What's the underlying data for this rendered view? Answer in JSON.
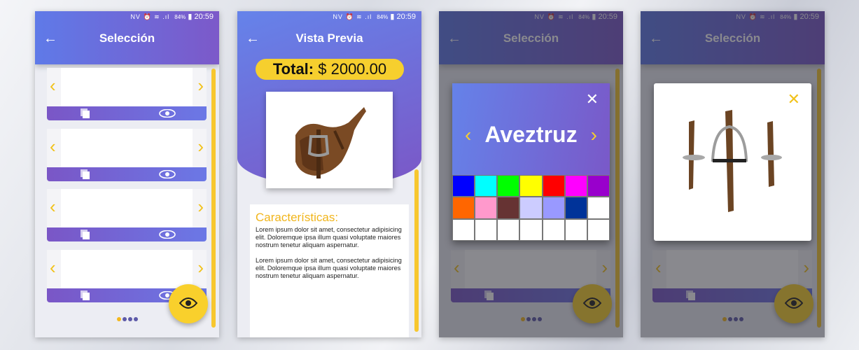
{
  "status": {
    "icons": "NV ⏰ ≋ .ıl",
    "battery": "84%",
    "time": "20:59"
  },
  "screens": {
    "selection": {
      "title": "Selección",
      "back": "←",
      "chev_left": "‹",
      "chev_right": "›"
    },
    "preview": {
      "title": "Vista Previa",
      "back": "←",
      "total_label": "Total:",
      "total_value": "$ 2000.00",
      "features_title": "Características:",
      "paragraphs": [
        "Lorem ipsum dolor sit amet, consectetur adipisicing elit. Doloremque ipsa illum quasi voluptate maiores nostrum tenetur aliquam aspernatur.",
        "Lorem ipsum dolor sit amet, consectetur adipisicing elit. Doloremque ipsa illum quasi voluptate maiores nostrum tenetur aliquam aspernatur."
      ]
    },
    "color_dialog": {
      "name": "Aveztruz",
      "close": "✕",
      "swatches": [
        "#0000ff",
        "#00ffff",
        "#00ff00",
        "#ffff00",
        "#ff0000",
        "#ff00ff",
        "#9900cc",
        "#ff6600",
        "#ff99cc",
        "#663333",
        "#ccccff",
        "#9999ff",
        "#003399",
        "#ffffff",
        "#ffffff",
        "#ffffff",
        "#ffffff",
        "#ffffff",
        "#ffffff",
        "#ffffff",
        "#ffffff"
      ]
    },
    "detail_dialog": {
      "close": "✕"
    }
  },
  "colors": {
    "primary_start": "#6583ea",
    "primary_end": "#7b56c6",
    "accent": "#f6cf2e",
    "leather": "#6b4423"
  }
}
